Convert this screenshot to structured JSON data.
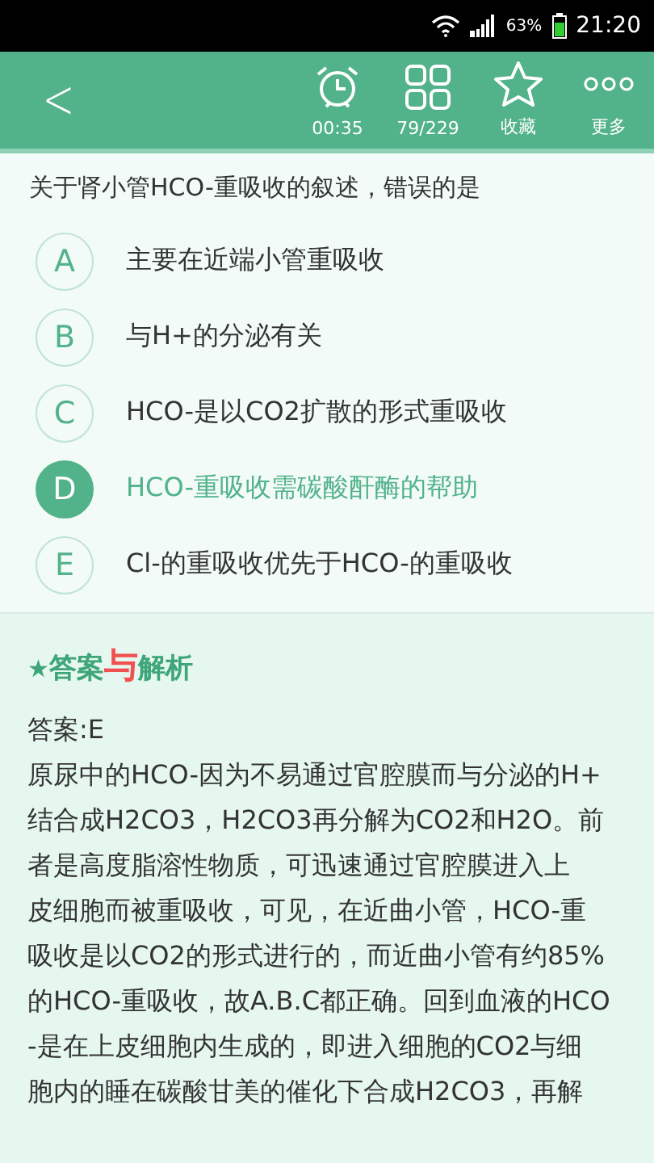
{
  "status_bar": {
    "battery_percent": "63%",
    "time": "21:20"
  },
  "toolbar": {
    "back": "<",
    "actions": [
      {
        "kind": "timer",
        "label": "00:35"
      },
      {
        "kind": "grid",
        "label": "79/229"
      },
      {
        "kind": "star",
        "label": "收藏"
      },
      {
        "kind": "more",
        "label": "更多"
      }
    ]
  },
  "question": "关于肾小管HCO-重吸收的叙述，错误的是",
  "options": [
    {
      "letter": "A",
      "text": "主要在近端小管重吸收",
      "selected": false
    },
    {
      "letter": "B",
      "text": "与H+的分泌有关",
      "selected": false
    },
    {
      "letter": "C",
      "text": "HCO-是以CO2扩散的形式重吸收",
      "selected": false
    },
    {
      "letter": "D",
      "text": "HCO-重吸收需碳酸酐酶的帮助",
      "selected": true
    },
    {
      "letter": "E",
      "text": "Cl-的重吸收优先于HCO-的重吸收",
      "selected": false
    }
  ],
  "analysis": {
    "title": {
      "star": "★",
      "before": "答案",
      "joiner": "与",
      "after": "解析"
    },
    "answer": "答案:E",
    "lines": [
      "原尿中的HCO-因为不易通过官腔膜而与分泌的H+",
      "结合成H2CO3，H2CO3再分解为CO2和H2O。前",
      "者是高度脂溶性物质，可迅速通过官腔膜进入上",
      "皮细胞而被重吸收，可见，在近曲小管，HCO-重",
      "吸收是以CO2的形式进行的，而近曲小管有约85%",
      "的HCO-重吸收，故A.B.C都正确。回到血液的HCO",
      "-是在上皮细胞内生成的，即进入细胞的CO2与细",
      "胞内的睡在碳酸甘美的催化下合成H2CO3，再解"
    ]
  }
}
